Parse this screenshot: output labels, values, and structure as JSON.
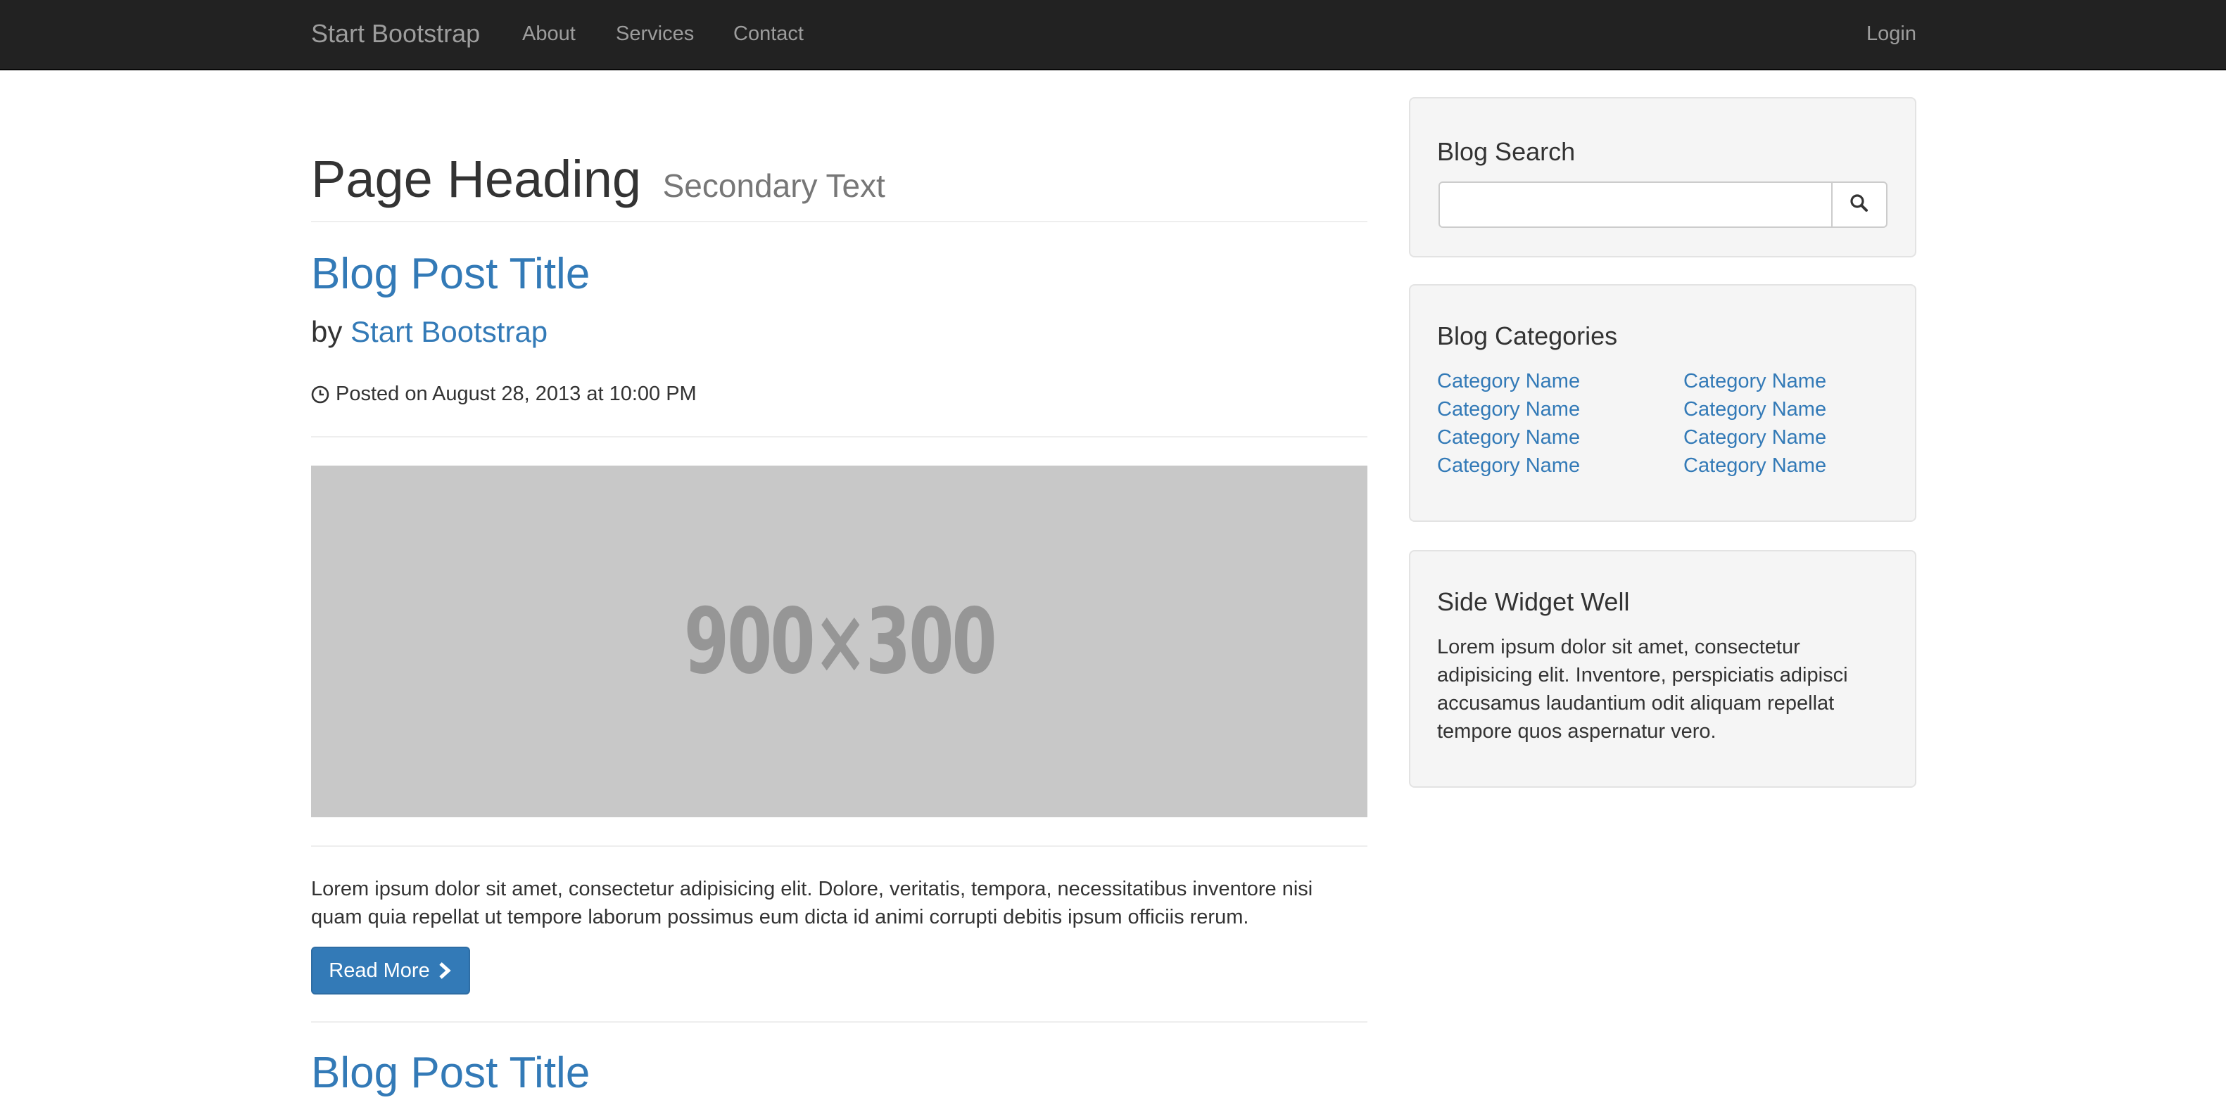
{
  "navbar": {
    "brand": "Start Bootstrap",
    "links": [
      "About",
      "Services",
      "Contact"
    ],
    "login": "Login"
  },
  "main": {
    "heading": "Page Heading",
    "heading_secondary": "Secondary Text",
    "posts": [
      {
        "title": "Blog Post Title",
        "by_prefix": "by",
        "author": "Start Bootstrap",
        "posted": "Posted on August 28, 2013 at 10:00 PM",
        "image_text": "900×300",
        "excerpt": "Lorem ipsum dolor sit amet, consectetur adipisicing elit. Dolore, veritatis, tempora, necessitatibus inventore nisi quam quia repellat ut tempore laborum possimus eum dicta id animi corrupti debitis ipsum officiis rerum.",
        "read_more": "Read More"
      },
      {
        "title": "Blog Post Title"
      }
    ]
  },
  "sidebar": {
    "search": {
      "title": "Blog Search",
      "placeholder": ""
    },
    "categories": {
      "title": "Blog Categories",
      "left": [
        "Category Name",
        "Category Name",
        "Category Name",
        "Category Name"
      ],
      "right": [
        "Category Name",
        "Category Name",
        "Category Name",
        "Category Name"
      ]
    },
    "side_widget": {
      "title": "Side Widget Well",
      "text": "Lorem ipsum dolor sit amet, consectetur adipisicing elit. Inventore, perspiciatis adipisci accusamus laudantium odit aliquam repellat tempore quos aspernatur vero."
    }
  },
  "icons": {
    "clock": "clock-icon",
    "chevron": "chevron-right-icon",
    "search": "search-icon"
  },
  "colors": {
    "navbar_bg": "#222222",
    "link": "#337ab7",
    "placeholder_bg": "#c8c8c8",
    "well_bg": "#f5f5f5"
  }
}
